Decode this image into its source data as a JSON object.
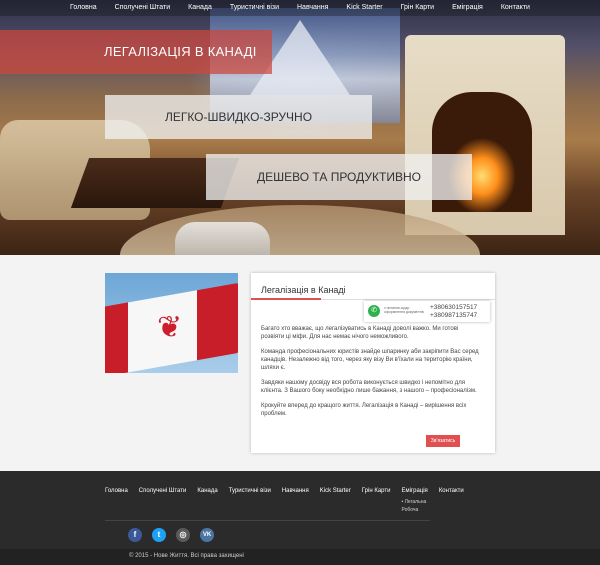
{
  "nav": {
    "items": [
      "Головна",
      "Сполучені Штати",
      "Канада",
      "Туристичні візи",
      "Навчання",
      "Kick Starter",
      "Грін Карти",
      "Еміграція",
      "Контакти"
    ]
  },
  "hero": {
    "title": "ЛЕГАЛІЗАЦІЯ В КАНАДІ",
    "slogan1": "ЛЕГКО-ШВИДКО-ЗРУЧНО",
    "slogan2": "ДЕШЕВО ТА ПРОДУКТИВНО"
  },
  "card": {
    "title": "Легалізація в Канаді",
    "contact_note": "з питання щодо оформлення документів",
    "phone1": "+380630157517",
    "phone2": "+380987135747",
    "paragraphs": [
      "Багато хто вважає, що легалізуватись в Канаді доволі важко. Ми готові розвіяти ці міфи. Для нас немає нічого неможливого.",
      "Команда професіональних юристів знайде шпаринку аби закріпити Вас серед канадців. Незалежно від того, через яку візу Ви в'їхали на територію країни, шляхи є.",
      "Завдяки нашому досвіду вся робота виконується швидко і непомітно для клієнта. З Вашого боку необхідно лише бажання, з нашого – професіоналізм.",
      "Крокуйте вперед до кращого життя. Легалізація в Канаді – вирішення всіх проблем."
    ],
    "button": "Зв'язатись"
  },
  "footer": {
    "nav": [
      "Головна",
      "Сполучені Штати",
      "Канада",
      "Туристичні візи",
      "Навчання",
      "Kick Starter",
      "Грін Карти",
      "Еміграція",
      "Контакти"
    ],
    "submenu": [
      "• Легальна",
      "Робоча"
    ],
    "socials": [
      "f",
      "t",
      "◎",
      "VK"
    ],
    "copyright": "© 2015 - Нове Життя. Всі права захищені"
  },
  "colors": {
    "accent": "#e05050",
    "footer_bg": "#2b2b2b",
    "banner_red": "#cf463c"
  }
}
